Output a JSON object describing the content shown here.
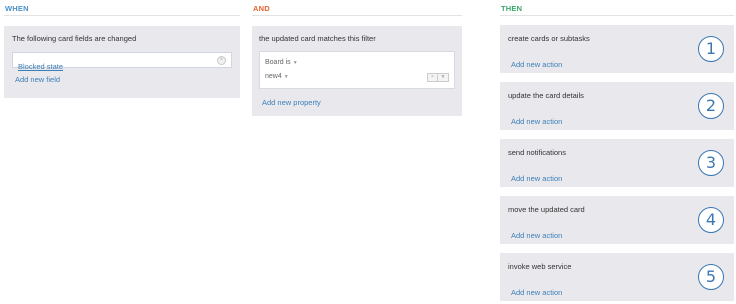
{
  "when": {
    "header": "WHEN",
    "title": "The following card fields are changed",
    "field_value": "Blocked state",
    "add_link": "Add new field"
  },
  "and": {
    "header": "AND",
    "title": "the updated card matches this filter",
    "filter": {
      "line1": "Board is",
      "line2": "new4"
    },
    "add_link": "Add new property"
  },
  "then": {
    "header": "THEN",
    "actions": [
      {
        "title": "create cards or subtasks",
        "link": "Add new action",
        "number": "1"
      },
      {
        "title": "update the card details",
        "link": "Add new action",
        "number": "2"
      },
      {
        "title": "send notifications",
        "link": "Add new action",
        "number": "3"
      },
      {
        "title": "move the updated card",
        "link": "Add new action",
        "number": "4"
      },
      {
        "title": "invoke web service",
        "link": "Add new action",
        "number": "5"
      }
    ]
  },
  "colors": {
    "when": "#4a90c8",
    "and": "#e8632f",
    "then": "#3aa86b",
    "link": "#3d7fb8",
    "panel_bg": "#e9e9ed"
  },
  "icons": [
    "clear-icon",
    "chevron-down-icon",
    "number-circle-icon"
  ]
}
